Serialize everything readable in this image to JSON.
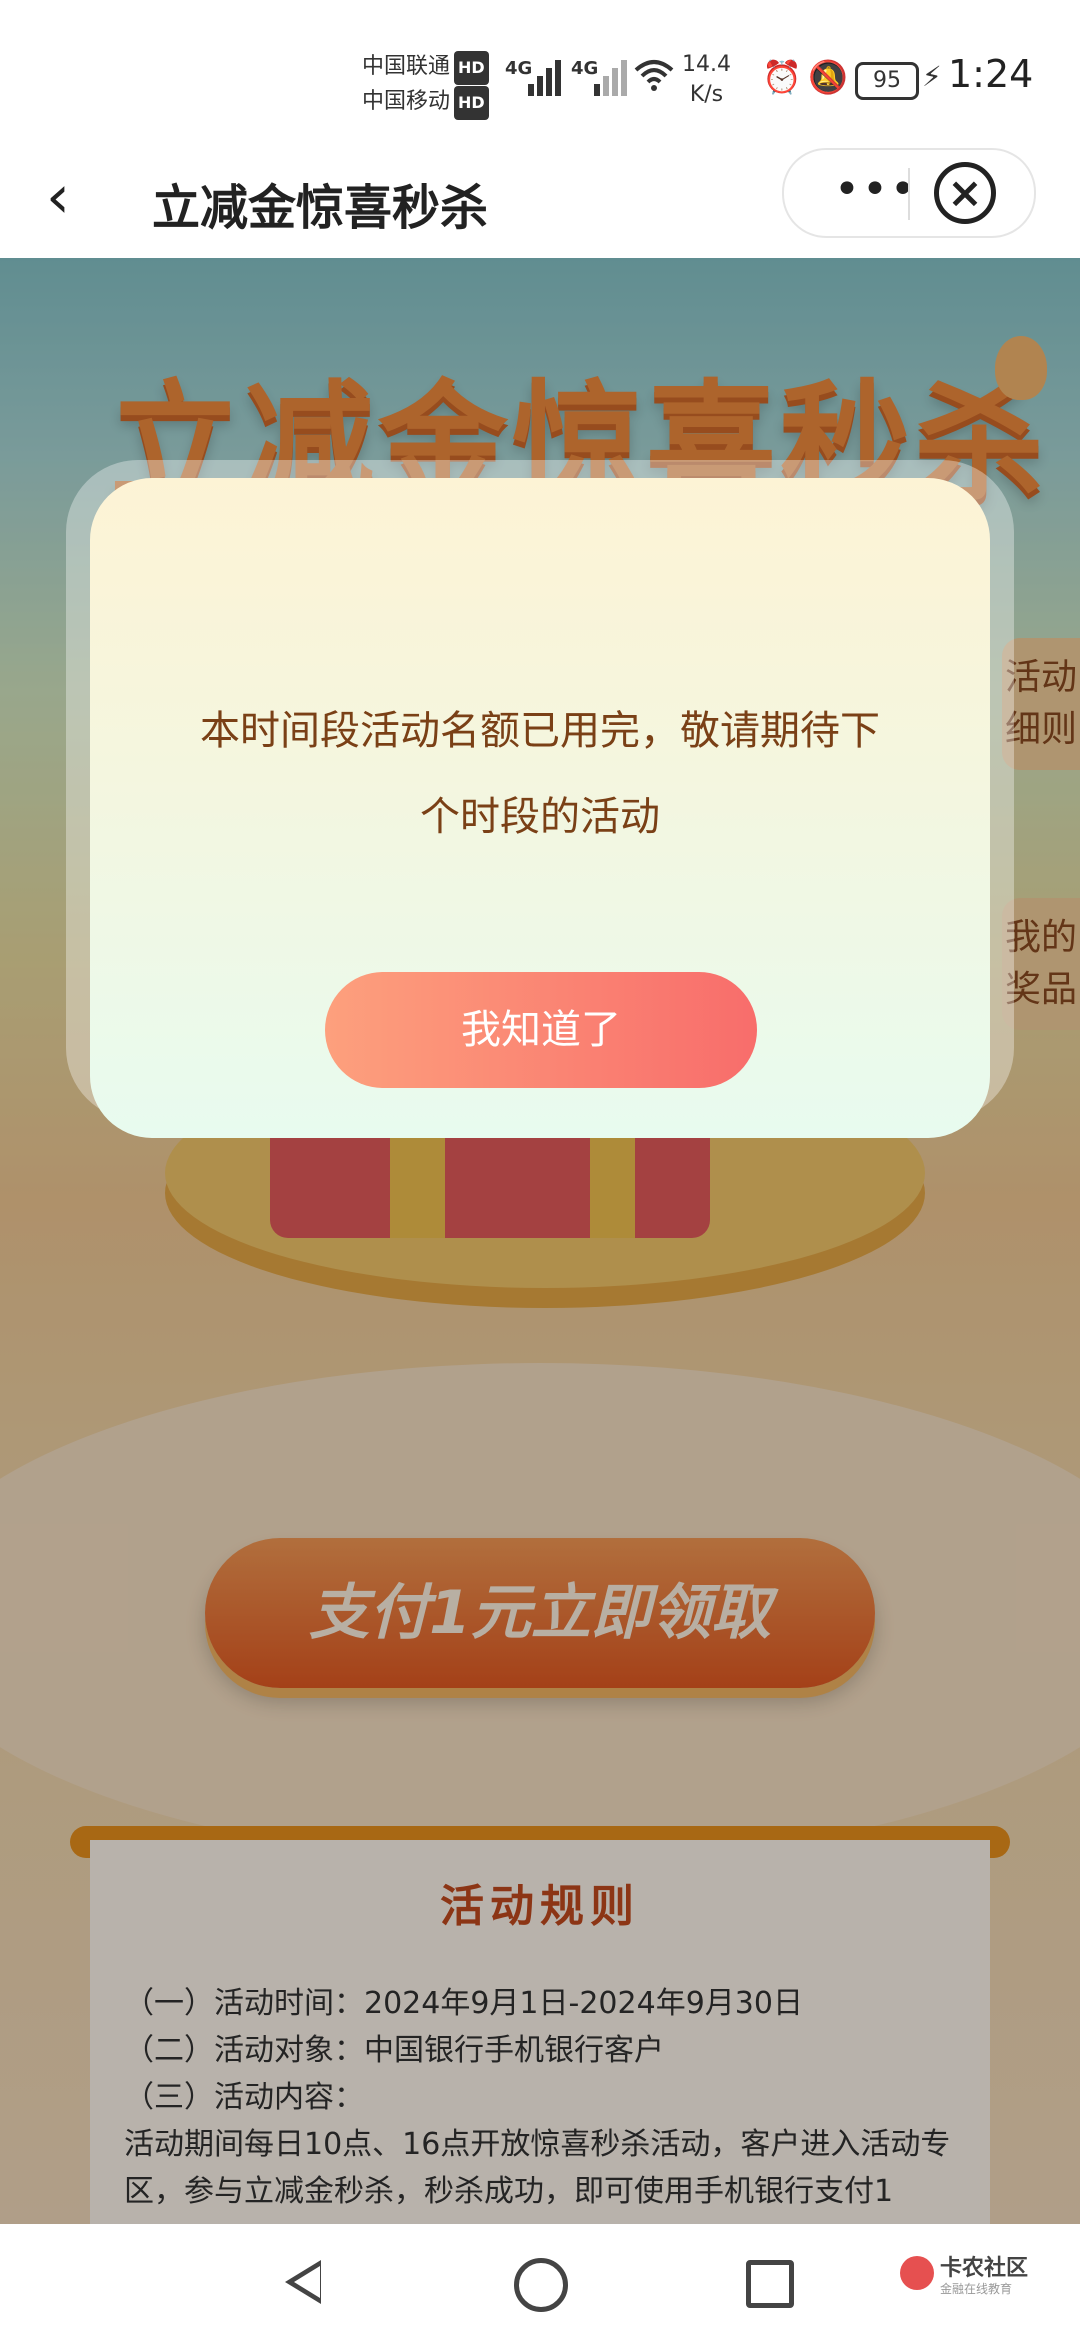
{
  "status_bar": {
    "carrier1": "中国联通",
    "carrier2": "中国移动",
    "hd": "HD",
    "net1": "4G",
    "net2": "4G",
    "speed_value": "14.4",
    "speed_unit": "K/s",
    "battery": "95",
    "time": "1:24"
  },
  "nav": {
    "title": "立减金惊喜秒杀",
    "more": "•••",
    "close": "×"
  },
  "page": {
    "hero_title": "立减金惊喜秒杀",
    "side_tab_1": "活动细则",
    "side_tab_2": "我的奖品",
    "claim_button": "支付1元立即领取",
    "rules": {
      "title": "活动规则",
      "line1": "（一）活动时间：2024年9月1日-2024年9月30日",
      "line2": "（二）活动对象：中国银行手机银行客户",
      "line3": "（三）活动内容：",
      "line4": "活动期间每日10点、16点开放惊喜秒杀活动，客户进入活动专区，参与立减金秒杀，秒杀成功，即可使用手机银行支付1"
    }
  },
  "dialog": {
    "message_line1": "本时间段活动名额已用完，敬请期待下",
    "message_line2": "个时段的活动",
    "confirm_button": "我知道了"
  },
  "watermark": {
    "name": "卡农社区",
    "sub": "金融在线教育"
  }
}
